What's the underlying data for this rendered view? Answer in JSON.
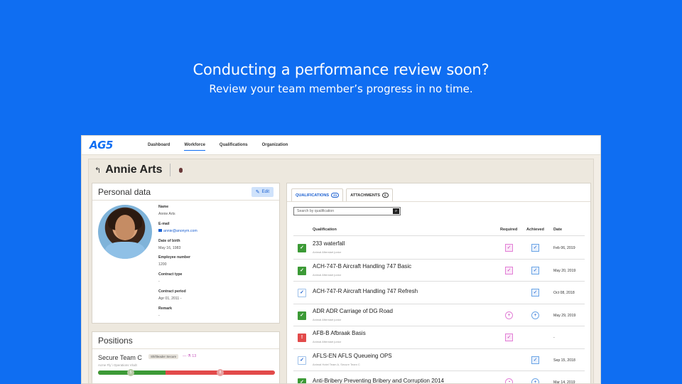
{
  "hero": {
    "title": "Conducting a performance review soon?",
    "subtitle": "Review your team member’s progress in no time."
  },
  "nav": {
    "logo": "AG5",
    "items": [
      "Dashboard",
      "Workforce",
      "Qualifications",
      "Organization"
    ],
    "active": "Workforce"
  },
  "page": {
    "title": "Annie Arts"
  },
  "personal": {
    "title": "Personal data",
    "edit_label": "Edit",
    "fields": [
      {
        "label": "Name",
        "value": "Annie Arts"
      },
      {
        "label": "E-mail",
        "value": "annie@anonym.com"
      },
      {
        "label": "Date of birth",
        "value": "May 16, 1983"
      },
      {
        "label": "Employee number",
        "value": "1200"
      },
      {
        "label": "Contract type",
        "value": "-"
      },
      {
        "label": "Contract period",
        "value": "Apr 01, 2011 -"
      },
      {
        "label": "Remark",
        "value": "-"
      }
    ]
  },
  "positions": {
    "title": "Positions",
    "item": {
      "name": "Secure Team C",
      "tag": "Shiftleader Secure",
      "count": "13",
      "subtitle": "Acme Fly \\ Operations Vlodt",
      "progress_done": 0.38,
      "marker_a": "5",
      "marker_b": "8"
    }
  },
  "qualifications": {
    "tabs": [
      {
        "label": "QUALIFICATIONS",
        "badge": "21"
      },
      {
        "label": "ATTACHMENTS",
        "badge": "0"
      }
    ],
    "search_placeholder": "Search by qualification",
    "columns": [
      "Qualification",
      "Required",
      "Achieved",
      "Date"
    ],
    "rows": [
      {
        "status": "ok",
        "name": "233 waterfall",
        "sub": "Animal Afterstart junior",
        "required": "check",
        "achieved": "check",
        "date": "Feb 06, 2019"
      },
      {
        "status": "ok",
        "name": "ACH-747-B Aircraft Handling 747 Basic",
        "sub": "Animal Afterstart junior",
        "required": "check",
        "achieved": "check",
        "date": "May 20, 2019"
      },
      {
        "status": "pending",
        "name": "ACH-747-R Aircraft Handling 747 Refresh",
        "sub": "",
        "required": "",
        "achieved": "check",
        "date": "Oct 08, 2018"
      },
      {
        "status": "ok",
        "name": "ADR ADR Carriage of DG Road",
        "sub": "Animal Afterstart junior",
        "required": "cross",
        "achieved": "cross",
        "date": "May 29, 2019"
      },
      {
        "status": "err",
        "name": "AFB-B Afbraak Basis",
        "sub": "Animal Afterstart junior",
        "required": "check",
        "achieved": "",
        "date": "-"
      },
      {
        "status": "pending",
        "name": "AFLS-EN AFLS Queueing OPS",
        "sub": "Animal Hotel Team A, Secure Team C",
        "required": "",
        "achieved": "check",
        "date": "Sep 15, 2018"
      },
      {
        "status": "ok",
        "name": "Anti-Bribery Preventing Bribery and Corruption 2014",
        "sub": "",
        "required": "pie",
        "achieved": "cross",
        "date": "Mar 14, 2019"
      }
    ]
  }
}
